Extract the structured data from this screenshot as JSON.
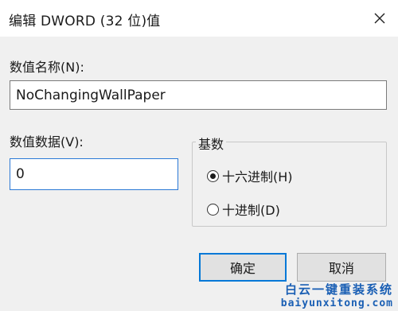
{
  "window": {
    "title": "编辑 DWORD (32 位)值"
  },
  "name_field": {
    "label": "数值名称(N):",
    "value": "NoChangingWallPaper"
  },
  "data_field": {
    "label": "数值数据(V):",
    "value": "0"
  },
  "base_group": {
    "title": "基数",
    "options": [
      {
        "label": "十六进制(H)",
        "selected": true
      },
      {
        "label": "十进制(D)",
        "selected": false
      }
    ]
  },
  "buttons": {
    "ok": "确定",
    "cancel": "取消"
  },
  "watermark": {
    "line1": "白云一键重装系统",
    "line2": "baiyunxitong.com"
  },
  "colors": {
    "accent": "#0078d7",
    "input_focus": "#2b79d6",
    "dialog_bg": "#f0f0f0"
  }
}
